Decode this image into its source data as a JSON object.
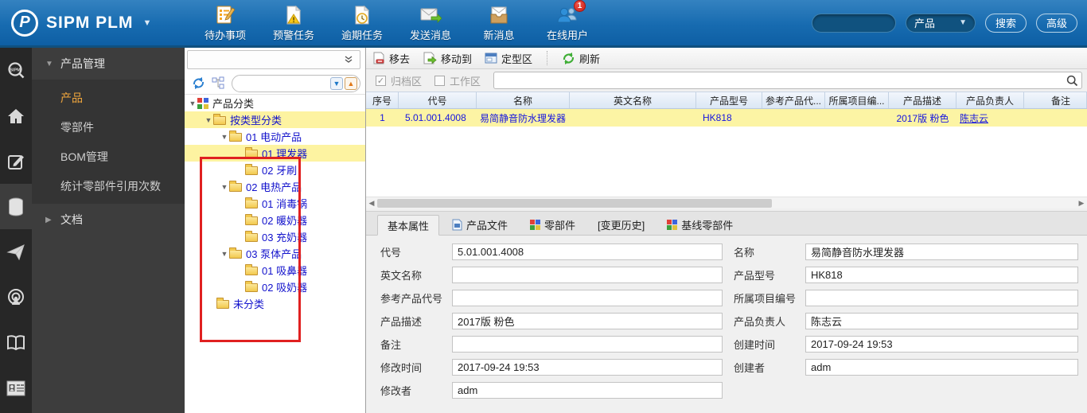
{
  "header": {
    "logo_text": "SIPM PLM",
    "logo_glyph": "P",
    "nav_items": [
      {
        "icon": "todo-icon",
        "label": "待办事项"
      },
      {
        "icon": "warning-task-icon",
        "label": "预警任务"
      },
      {
        "icon": "overdue-task-icon",
        "label": "逾期任务"
      },
      {
        "icon": "send-message-icon",
        "label": "发送消息"
      },
      {
        "icon": "new-message-icon",
        "label": "新消息"
      },
      {
        "icon": "online-users-icon",
        "label": "在线用户",
        "badge": "1"
      }
    ],
    "search": {
      "value": "",
      "scope": "产品",
      "search_label": "搜索",
      "advanced_label": "高级"
    }
  },
  "sidebar": {
    "icons": [
      "sipm-search-icon",
      "home-icon",
      "edit-icon",
      "database-icon",
      "send-plane-icon",
      "broadcast-icon",
      "book-icon",
      "contact-card-icon"
    ],
    "selected_icon": "database-icon",
    "menu": {
      "section1": {
        "label": "产品管理"
      },
      "items": [
        {
          "label": "产品",
          "selected": true
        },
        {
          "label": "零部件"
        },
        {
          "label": "BOM管理"
        },
        {
          "label": "统计零部件引用次数"
        }
      ],
      "section2": {
        "label": "文档"
      }
    }
  },
  "tree": {
    "filter_value": "",
    "items": [
      {
        "label": "产品分类"
      },
      {
        "label": "按类型分类"
      },
      {
        "label": "01 电动产品"
      },
      {
        "label": "01 理发器"
      },
      {
        "label": "02 牙刷"
      },
      {
        "label": "02 电热产品"
      },
      {
        "label": "01 消毒锅"
      },
      {
        "label": "02 暖奶器"
      },
      {
        "label": "03 充奶器"
      },
      {
        "label": "03 泵体产品"
      },
      {
        "label": "01 吸鼻器"
      },
      {
        "label": "02 吸奶器"
      },
      {
        "label": "未分类"
      }
    ]
  },
  "toolbar": {
    "remove_label": "移去",
    "move_to_label": "移动到",
    "fixed_area_label": "定型区",
    "refresh_label": "刷新"
  },
  "filters": {
    "archive_label": "归档区",
    "workspace_label": "工作区",
    "search_value": ""
  },
  "table": {
    "columns": [
      "序号",
      "代号",
      "名称",
      "英文名称",
      "产品型号",
      "参考产品代...",
      "所属项目编...",
      "产品描述",
      "产品负责人",
      "备注"
    ],
    "row": {
      "cells": [
        "1",
        "5.01.001.4008",
        "易简静音防水理发器",
        "",
        "HK818",
        "",
        "",
        "2017版 粉色",
        "陈志云",
        ""
      ]
    }
  },
  "tabs": [
    {
      "label": "基本属性",
      "active": true
    },
    {
      "label": "产品文件",
      "icon": "document-icon"
    },
    {
      "label": "零部件",
      "icon": "parts-grid-icon"
    },
    {
      "label": "[变更历史]"
    },
    {
      "label": "基线零部件",
      "icon": "parts-grid-icon"
    }
  ],
  "form": {
    "left": [
      {
        "label": "代号",
        "value": "5.01.001.4008"
      },
      {
        "label": "英文名称",
        "value": ""
      },
      {
        "label": "参考产品代号",
        "value": ""
      },
      {
        "label": "产品描述",
        "value": "2017版 粉色"
      },
      {
        "label": "备注",
        "value": ""
      },
      {
        "label": "修改时间",
        "value": "2017-09-24 19:53"
      },
      {
        "label": "修改者",
        "value": "adm"
      }
    ],
    "right": [
      {
        "label": "名称",
        "value": "易简静音防水理发器"
      },
      {
        "label": "产品型号",
        "value": "HK818"
      },
      {
        "label": "所属项目编号",
        "value": ""
      },
      {
        "label": "产品负责人",
        "value": "陈志云"
      },
      {
        "label": "创建时间",
        "value": "2017-09-24 19:53"
      },
      {
        "label": "创建者",
        "value": "adm"
      }
    ]
  },
  "colors": {
    "header_blue": "#176bb0",
    "highlight_yellow": "#fcf4a4",
    "selected_orange": "#f2a73d",
    "tree_link_blue": "#1212cc",
    "annotation_red": "#e02020"
  }
}
